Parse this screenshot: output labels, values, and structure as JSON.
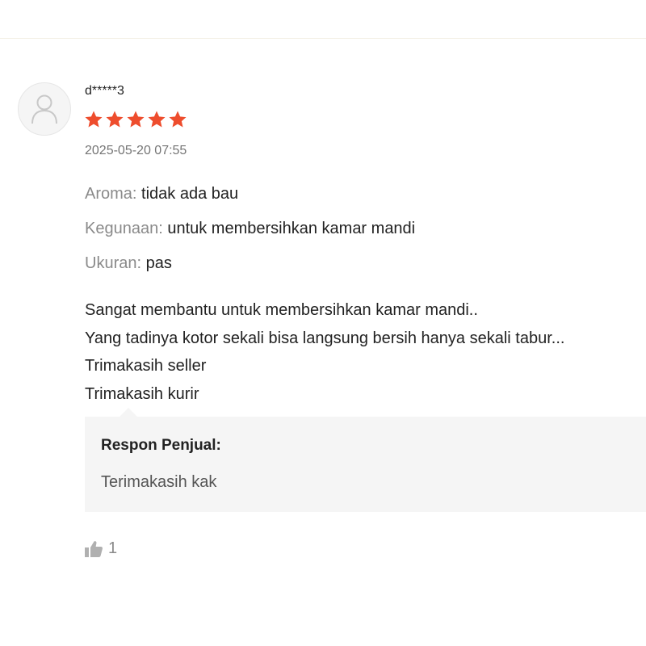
{
  "review": {
    "username": "d*****3",
    "rating": 5,
    "rating_max": 5,
    "timestamp": "2025-05-20 07:55",
    "attributes": [
      {
        "label": "Aroma:",
        "value": "tidak ada bau"
      },
      {
        "label": "Kegunaan:",
        "value": "untuk membersihkan kamar mandi"
      },
      {
        "label": "Ukuran:",
        "value": "pas"
      }
    ],
    "text_lines": [
      "Sangat membantu untuk membersihkan kamar mandi..",
      "Yang tadinya kotor sekali bisa langsung bersih hanya sekali tabur...",
      "Trimakasih seller",
      "Trimakasih kurir"
    ],
    "seller_response": {
      "title": "Respon Penjual:",
      "text": "Terimakasih kak"
    },
    "likes": "1"
  },
  "colors": {
    "star": "#ee4d2d",
    "muted_text": "#8a8a8a",
    "seller_box_bg": "#f5f5f5",
    "avatar_bg": "#f5f5f5"
  },
  "icons": {
    "avatar": "user-icon",
    "rating": "star-icon",
    "like": "thumbs-up-icon"
  }
}
